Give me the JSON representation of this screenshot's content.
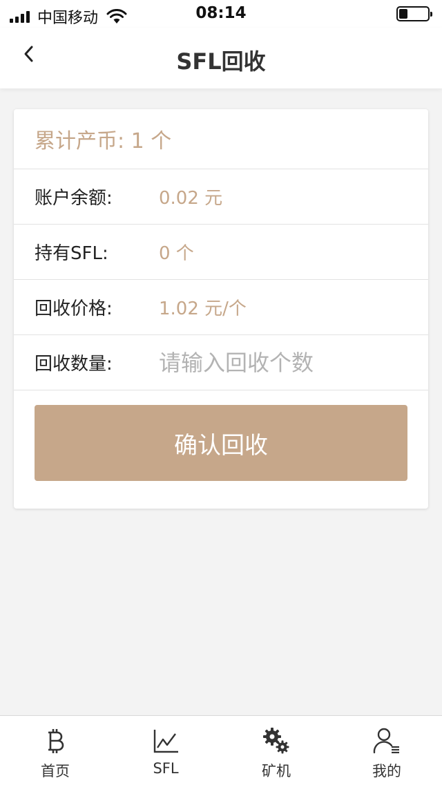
{
  "status_bar": {
    "carrier": "中国移动",
    "time": "08:14",
    "icons": [
      "signal-icon",
      "wifi-icon",
      "battery-icon"
    ]
  },
  "nav": {
    "title": "SFL回收",
    "back_icon": "chevron-left-icon"
  },
  "card": {
    "total_mined": "累计产币: 1 个",
    "rows": [
      {
        "label": "账户余额:",
        "value": "0.02 元"
      },
      {
        "label": "持有SFL:",
        "value": "0 个"
      },
      {
        "label": "回收价格:",
        "value": "1.02 元/个"
      }
    ],
    "quantity": {
      "label": "回收数量:",
      "value": "",
      "placeholder": "请输入回收个数"
    },
    "confirm_label": "确认回收"
  },
  "tabbar": {
    "items": [
      {
        "label": "首页",
        "icon": "bitcoin-icon"
      },
      {
        "label": "SFL",
        "icon": "line-chart-icon"
      },
      {
        "label": "矿机",
        "icon": "gears-icon"
      },
      {
        "label": "我的",
        "icon": "user-icon"
      }
    ]
  },
  "colors": {
    "accent": "#c6a78a",
    "background": "#f3f3f3",
    "text": "#222222",
    "placeholder": "#b3b3b3"
  }
}
